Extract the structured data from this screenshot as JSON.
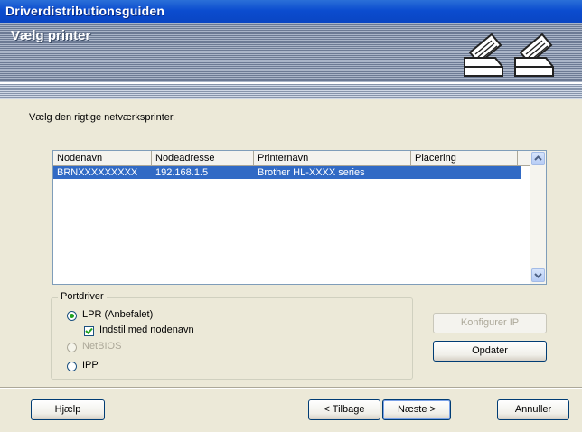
{
  "window": {
    "title": "Driverdistributionsguiden"
  },
  "banner": {
    "title": "Vælg printer",
    "icons": [
      "printer-icon",
      "printer-icon"
    ]
  },
  "instruction": "Vælg den rigtige netværksprinter.",
  "list": {
    "columns": [
      "Nodenavn",
      "Nodeadresse",
      "Printernavn",
      "Placering"
    ],
    "rows": [
      {
        "nodenavn": "BRNXXXXXXXXX",
        "nodeadresse": "192.168.1.5",
        "printernavn": "Brother HL-XXXX series",
        "placering": ""
      }
    ]
  },
  "portdriver": {
    "label": "Portdriver",
    "lpr": "LPR (Anbefalet)",
    "lpr_checkbox": "Indstil med nodenavn",
    "netbios": "NetBIOS",
    "ipp": "IPP"
  },
  "buttons": {
    "configure_ip": "Konfigurer IP",
    "update": "Opdater",
    "help": "Hjælp",
    "back": "< Tilbage",
    "next": "Næste >",
    "cancel": "Annuller"
  },
  "colors": {
    "titlebar": "#0a45c2",
    "selection": "#316ac5",
    "radio_dot": "#21a121"
  }
}
